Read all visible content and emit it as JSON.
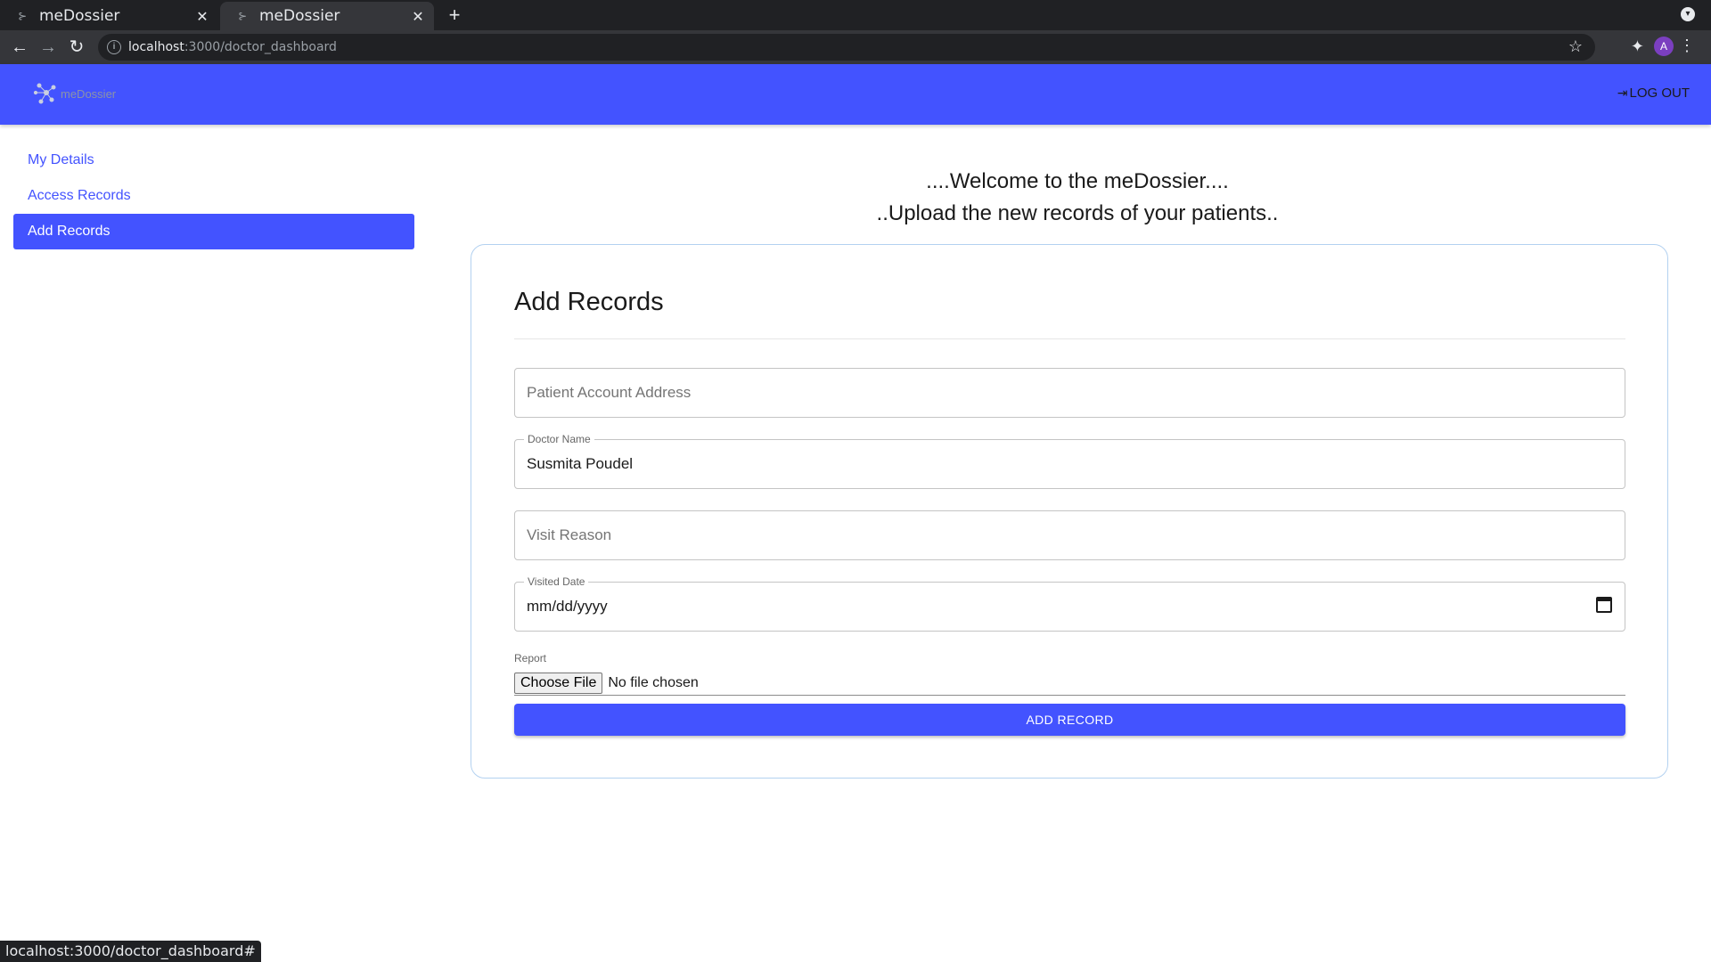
{
  "browser": {
    "tabs": [
      {
        "title": "meDossier",
        "active": false
      },
      {
        "title": "meDossier",
        "active": true
      }
    ],
    "url_host": "localhost",
    "url_path": ":3000/doctor_dashboard",
    "status_url": "localhost:3000/doctor_dashboard#",
    "profile_initial": "A"
  },
  "header": {
    "logo_text": "meDossier",
    "logout_label": "LOG OUT",
    "brand_color": "#4353ff"
  },
  "sidebar": {
    "items": [
      {
        "label": "My Details",
        "active": false
      },
      {
        "label": "Access Records",
        "active": false
      },
      {
        "label": "Add Records",
        "active": true
      }
    ]
  },
  "main": {
    "welcome_line1": "....Welcome to the meDossier....",
    "welcome_line2": "..Upload the new records of your patients..",
    "form": {
      "title": "Add Records",
      "patient_address": {
        "placeholder": "Patient Account Address",
        "value": ""
      },
      "doctor_name": {
        "label": "Doctor Name",
        "value": "Susmita Poudel"
      },
      "visit_reason": {
        "placeholder": "Visit Reason",
        "value": ""
      },
      "visited_date": {
        "label": "Visited Date",
        "value": "mm/dd/yyyy"
      },
      "report": {
        "label": "Report",
        "button": "Choose File",
        "status": "No file chosen"
      },
      "submit_label": "ADD RECORD"
    }
  }
}
